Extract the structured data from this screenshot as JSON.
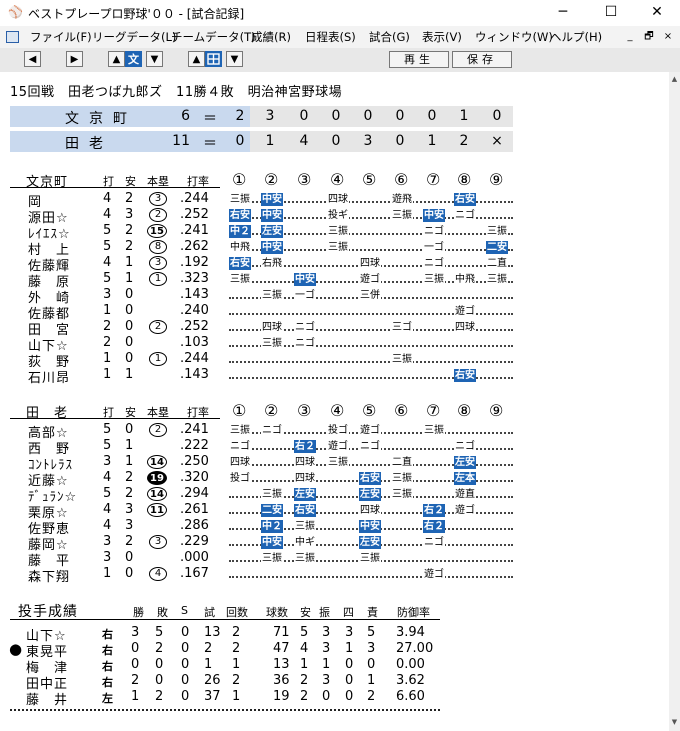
{
  "window": {
    "title": "ベストプレープロ野球'００ - [試合記録]",
    "controls": {
      "minimize": "─",
      "maximize": "☐",
      "close": "✕"
    }
  },
  "menubar": {
    "items": [
      "ファイル(F)",
      "リーグデータ(L)",
      "チームデータ(T)",
      "成績(R)",
      "日程表(S)",
      "試合(G)",
      "表示(V)",
      "ウィンドウ(W)",
      "ヘルプ(H)"
    ],
    "mdi": {
      "minimize": "_",
      "restore": "🗗",
      "close": "×"
    }
  },
  "toolbar": {
    "team_left": "文",
    "team_right": "田",
    "play_label": "再生",
    "save_label": "保存"
  },
  "game_info": "15回戦　田老つば九郎ズ　11勝４敗　明治神宮野球場",
  "scoreboard": [
    {
      "team": "文京町",
      "total": "6",
      "eq": "＝",
      "innings": [
        "2",
        "3",
        "0",
        "0",
        "0",
        "0",
        "0",
        "1",
        "0"
      ]
    },
    {
      "team": "田老",
      "total": "11",
      "eq": "＝",
      "innings": [
        "0",
        "1",
        "4",
        "0",
        "3",
        "0",
        "1",
        "2",
        "×"
      ]
    }
  ],
  "batting": [
    {
      "team": "文京町",
      "headers": {
        "ab": "打",
        "h": "安",
        "hr": "本塁",
        "avg": "打率"
      },
      "inning_headers": [
        "①",
        "②",
        "③",
        "④",
        "⑤",
        "⑥",
        "⑦",
        "⑧",
        "⑨"
      ],
      "players": [
        {
          "name": "岡",
          "ab": "4",
          "h": "2",
          "hr": "3",
          "avg": ".244",
          "pa": [
            [
              "三振",
              false
            ],
            [
              "中安",
              true
            ],
            null,
            [
              "四球",
              false
            ],
            null,
            [
              "遊飛",
              false
            ],
            null,
            [
              "右安",
              true
            ],
            null
          ]
        },
        {
          "name": "源田☆",
          "ab": "4",
          "h": "3",
          "hr": "2",
          "avg": ".252",
          "pa": [
            [
              "右安",
              true
            ],
            [
              "中安",
              true
            ],
            null,
            [
              "投ギ",
              false
            ],
            null,
            [
              "三振",
              false
            ],
            [
              "中安",
              true
            ],
            [
              "ニゴ",
              false
            ],
            null
          ]
        },
        {
          "name": "ﾚｲｴｽ☆",
          "ab": "5",
          "h": "2",
          "hr": "15",
          "avg": ".241",
          "pa": [
            [
              "中２",
              true
            ],
            [
              "左安",
              true
            ],
            null,
            [
              "三振",
              false
            ],
            null,
            null,
            [
              "ニゴ",
              false
            ],
            null,
            [
              "三振",
              false
            ]
          ]
        },
        {
          "name": "村　上",
          "ab": "5",
          "h": "2",
          "hr": "8",
          "avg": ".262",
          "pa": [
            [
              "中飛",
              false
            ],
            [
              "中安",
              true
            ],
            null,
            [
              "三振",
              false
            ],
            null,
            null,
            [
              "一ゴ",
              false
            ],
            null,
            [
              "二安",
              true
            ]
          ]
        },
        {
          "name": "佐藤輝",
          "ab": "4",
          "h": "1",
          "hr": "3",
          "avg": ".192",
          "pa": [
            [
              "右安",
              true
            ],
            [
              "右飛",
              false
            ],
            null,
            null,
            [
              "四球",
              false
            ],
            null,
            [
              "ニゴ",
              false
            ],
            null,
            [
              "二直",
              false
            ]
          ]
        },
        {
          "name": "藤　原",
          "ab": "5",
          "h": "1",
          "hr": "1",
          "avg": ".323",
          "pa": [
            [
              "三振",
              false
            ],
            null,
            [
              "中安",
              true
            ],
            null,
            [
              "遊ゴ",
              false
            ],
            null,
            [
              "三振",
              false
            ],
            [
              "中飛",
              false
            ],
            [
              "三振",
              false
            ]
          ]
        },
        {
          "name": "外　崎",
          "ab": "3",
          "h": "0",
          "hr": "",
          "avg": ".143",
          "pa": [
            null,
            [
              "三振",
              false
            ],
            [
              "一ゴ",
              false
            ],
            null,
            [
              "三併",
              false
            ],
            null,
            null,
            null,
            null
          ]
        },
        {
          "name": "佐藤都",
          "ab": "1",
          "h": "0",
          "hr": "",
          "avg": ".240",
          "pa": [
            null,
            null,
            null,
            null,
            null,
            null,
            null,
            [
              "遊ゴ",
              false
            ],
            null
          ]
        },
        {
          "name": "田　宮",
          "ab": "2",
          "h": "0",
          "hr": "2",
          "avg": ".252",
          "pa": [
            null,
            [
              "四球",
              false
            ],
            [
              "ニゴ",
              false
            ],
            null,
            null,
            [
              "三ゴ",
              false
            ],
            null,
            [
              "四球",
              false
            ],
            null
          ]
        },
        {
          "name": "山下☆",
          "ab": "2",
          "h": "0",
          "hr": "",
          "avg": ".103",
          "pa": [
            null,
            [
              "三振",
              false
            ],
            [
              "ニゴ",
              false
            ],
            null,
            null,
            null,
            null,
            null,
            null
          ]
        },
        {
          "name": "荻　野",
          "ab": "1",
          "h": "0",
          "hr": "1",
          "avg": ".244",
          "pa": [
            null,
            null,
            null,
            null,
            null,
            [
              "三振",
              false
            ],
            null,
            null,
            null
          ]
        },
        {
          "name": "石川昂",
          "ab": "1",
          "h": "1",
          "hr": "",
          "avg": ".143",
          "pa": [
            null,
            null,
            null,
            null,
            null,
            null,
            null,
            [
              "右安",
              true
            ],
            null
          ]
        }
      ]
    },
    {
      "team": "田　老",
      "headers": {
        "ab": "打",
        "h": "安",
        "hr": "本塁",
        "avg": "打率"
      },
      "inning_headers": [
        "①",
        "②",
        "③",
        "④",
        "⑤",
        "⑥",
        "⑦",
        "⑧",
        "⑨"
      ],
      "players": [
        {
          "name": "高部☆",
          "ab": "5",
          "h": "0",
          "hr": "2",
          "avg": ".241",
          "pa": [
            [
              "三振",
              false
            ],
            [
              "ニゴ",
              false
            ],
            null,
            [
              "投ゴ",
              false
            ],
            [
              "遊ゴ",
              false
            ],
            null,
            [
              "三振",
              false
            ],
            null,
            null
          ]
        },
        {
          "name": "西　野",
          "ab": "5",
          "h": "1",
          "hr": "",
          "avg": ".222",
          "pa": [
            [
              "ニゴ",
              false
            ],
            null,
            [
              "右２",
              true
            ],
            [
              "遊ゴ",
              false
            ],
            [
              "ニゴ",
              false
            ],
            null,
            null,
            [
              "ニゴ",
              false
            ],
            null
          ]
        },
        {
          "name": "ｺﾝﾄﾚﾗｽ",
          "ab": "3",
          "h": "1",
          "hr": "14",
          "avg": ".250",
          "pa": [
            [
              "四球",
              false
            ],
            null,
            [
              "四球",
              false
            ],
            [
              "三振",
              false
            ],
            null,
            [
              "二直",
              false
            ],
            null,
            [
              "左安",
              true
            ],
            null
          ]
        },
        {
          "name": "近藤☆",
          "ab": "4",
          "h": "2",
          "hr": "19",
          "avg": ".320",
          "hrFilled": true,
          "pa": [
            [
              "投ゴ",
              false
            ],
            null,
            [
              "四球",
              false
            ],
            null,
            [
              "右安",
              true
            ],
            [
              "三振",
              false
            ],
            null,
            [
              "左本",
              true
            ],
            null
          ]
        },
        {
          "name": "ﾃﾞｭﾗﾝ☆",
          "ab": "5",
          "h": "2",
          "hr": "14",
          "avg": ".294",
          "pa": [
            null,
            [
              "三振",
              false
            ],
            [
              "左安",
              true
            ],
            null,
            [
              "左安",
              true
            ],
            [
              "三振",
              false
            ],
            null,
            [
              "遊直",
              false
            ],
            null
          ]
        },
        {
          "name": "栗原☆",
          "ab": "4",
          "h": "3",
          "hr": "11",
          "avg": ".261",
          "pa": [
            null,
            [
              "二安",
              true
            ],
            [
              "右安",
              true
            ],
            null,
            [
              "四球",
              false
            ],
            null,
            [
              "右２",
              true
            ],
            [
              "遊ゴ",
              false
            ],
            null
          ]
        },
        {
          "name": "佐野恵",
          "ab": "4",
          "h": "3",
          "hr": "",
          "avg": ".286",
          "pa": [
            null,
            [
              "中２",
              true
            ],
            [
              "三振",
              false
            ],
            null,
            [
              "中安",
              true
            ],
            null,
            [
              "右２",
              true
            ],
            null,
            null
          ]
        },
        {
          "name": "藤岡☆",
          "ab": "3",
          "h": "2",
          "hr": "3",
          "avg": ".229",
          "pa": [
            null,
            [
              "中安",
              true
            ],
            [
              "中ギ",
              false
            ],
            null,
            [
              "左安",
              true
            ],
            null,
            [
              "ニゴ",
              false
            ],
            null,
            null
          ]
        },
        {
          "name": "藤　平",
          "ab": "3",
          "h": "0",
          "hr": "",
          "avg": ".000",
          "pa": [
            null,
            [
              "三振",
              false
            ],
            [
              "三振",
              false
            ],
            null,
            [
              "三振",
              false
            ],
            null,
            null,
            null,
            null
          ]
        },
        {
          "name": "森下翔",
          "ab": "1",
          "h": "0",
          "hr": "4",
          "avg": ".167",
          "pa": [
            null,
            null,
            null,
            null,
            null,
            null,
            [
              "遊ゴ",
              false
            ],
            null,
            null
          ]
        }
      ]
    }
  ],
  "pitching": {
    "title": "投手成績",
    "headers": [
      "勝",
      "敗",
      "S",
      "試",
      "回数",
      "球数",
      "安",
      "振",
      "四",
      "責",
      "防御率"
    ],
    "pitchers": [
      {
        "mark": "",
        "name": "山下☆",
        "hand": "右",
        "w": "3",
        "l": "5",
        "s": "0",
        "g": "13",
        "ip": "2",
        "np": "71",
        "h": "5",
        "so": "3",
        "bb": "3",
        "er": "5",
        "era": "3.94"
      },
      {
        "mark": "●",
        "name": "東晃平",
        "hand": "右",
        "w": "0",
        "l": "2",
        "s": "0",
        "g": "2",
        "ip": "2",
        "np": "47",
        "h": "4",
        "so": "3",
        "bb": "1",
        "er": "3",
        "era": "27.00"
      },
      {
        "mark": "",
        "name": "梅　津",
        "hand": "右",
        "w": "0",
        "l": "0",
        "s": "0",
        "g": "1",
        "ip": "1",
        "np": "13",
        "h": "1",
        "so": "1",
        "bb": "0",
        "er": "0",
        "era": "0.00"
      },
      {
        "mark": "",
        "name": "田中正",
        "hand": "右",
        "w": "2",
        "l": "0",
        "s": "0",
        "g": "26",
        "ip": "2",
        "np": "36",
        "h": "2",
        "so": "3",
        "bb": "0",
        "er": "1",
        "era": "3.62"
      },
      {
        "mark": "",
        "name": "藤　井",
        "hand": "左",
        "w": "1",
        "l": "2",
        "s": "0",
        "g": "37",
        "ip": "1",
        "np": "19",
        "h": "2",
        "so": "0",
        "bb": "0",
        "er": "2",
        "era": "6.60"
      }
    ]
  },
  "colors": {
    "hit_bg": "#1e64b4",
    "scoreboard_team_bg": "#c9d9ee",
    "scoreboard_bg": "#e6e6e6"
  }
}
